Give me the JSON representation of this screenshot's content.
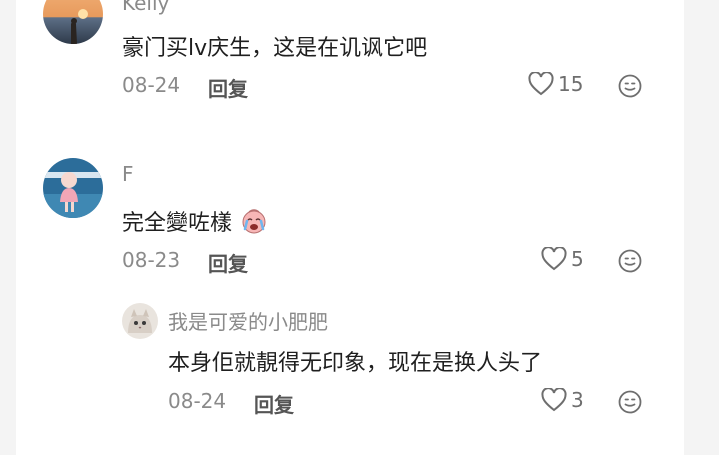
{
  "comments": [
    {
      "name": "Kelly",
      "text": "豪门买lv庆生，这是在讥讽它吧",
      "date": "08-24",
      "reply_label": "回复",
      "likes": "15",
      "avatar_icon": "sunset-photo-avatar"
    },
    {
      "name": "F",
      "text": "完全變咗樣",
      "text_emoji": "crying-face-emoji",
      "date": "08-23",
      "reply_label": "回复",
      "likes": "5",
      "avatar_icon": "child-photo-avatar",
      "replies": [
        {
          "name": "我是可爱的小肥肥",
          "text": "本身佢就靚得无印象，现在是换人头了",
          "date": "08-24",
          "reply_label": "回复",
          "likes": "3",
          "avatar_icon": "cat-photo-avatar"
        }
      ]
    }
  ],
  "colors": {
    "text": "#1f1f1f",
    "muted": "#8a8a8a",
    "background": "#ffffff",
    "page": "#ececec"
  }
}
